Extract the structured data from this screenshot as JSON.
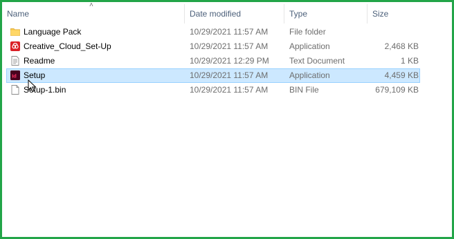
{
  "columns": {
    "name": "Name",
    "date": "Date modified",
    "type": "Type",
    "size": "Size"
  },
  "files": [
    {
      "name": "Language Pack",
      "date": "10/29/2021 11:57 AM",
      "type": "File folder",
      "size": "",
      "icon": "folder-icon"
    },
    {
      "name": "Creative_Cloud_Set-Up",
      "date": "10/29/2021 11:57 AM",
      "type": "Application",
      "size": "2,468 KB",
      "icon": "creative-cloud-icon"
    },
    {
      "name": "Readme",
      "date": "10/29/2021 12:29 PM",
      "type": "Text Document",
      "size": "1 KB",
      "icon": "text-document-icon"
    },
    {
      "name": "Setup",
      "date": "10/29/2021 11:57 AM",
      "type": "Application",
      "size": "4,459 KB",
      "icon": "indesign-icon",
      "selected": true
    },
    {
      "name": "Setup-1.bin",
      "date": "10/29/2021 11:57 AM",
      "type": "BIN File",
      "size": "679,109 KB",
      "icon": "file-icon"
    }
  ],
  "icons": {
    "indesign_label": "Id"
  },
  "colors": {
    "frame": "#22a548",
    "selection": "#cce8ff",
    "selection_border": "#99d1ff",
    "header_text": "#4c607a",
    "indesign": "#49021f"
  }
}
